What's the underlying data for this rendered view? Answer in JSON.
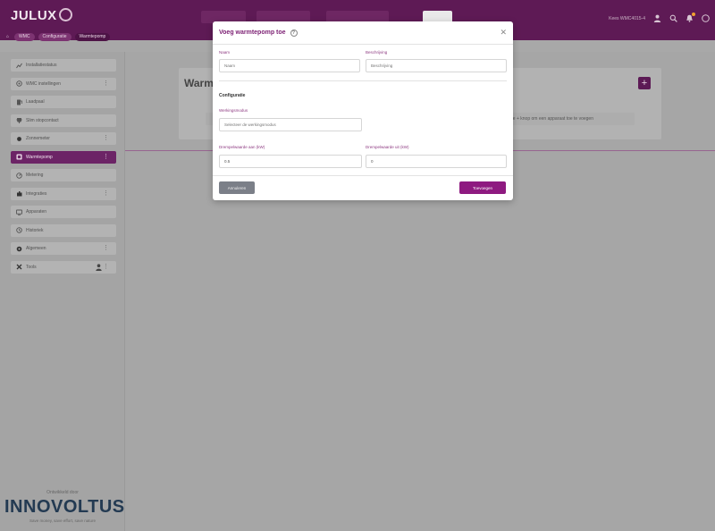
{
  "header": {
    "logo": "JULUX",
    "breadcrumbs": [
      "WMC",
      "Configuratie",
      "Warmtepomp"
    ],
    "account": "Kees WMC4015-4",
    "colors": {
      "brand": "#5e1a55",
      "accent": "#8e1a80"
    }
  },
  "sidebar": {
    "items": [
      {
        "label": "Installatiestatus",
        "icon": "chart-icon",
        "more": ""
      },
      {
        "label": "WMC instellingen",
        "icon": "settings-icon",
        "more": "⋮"
      },
      {
        "label": "Laadpaal",
        "icon": "charger-icon",
        "more": ""
      },
      {
        "label": "Slim stopcontact",
        "icon": "plug-icon",
        "more": ""
      },
      {
        "label": "Zonnemeter",
        "icon": "sun-icon",
        "more": "⋮"
      },
      {
        "label": "Warmtepomp",
        "icon": "heatpump-icon",
        "more": "⋮"
      },
      {
        "label": "Metering",
        "icon": "meter-icon",
        "more": ""
      },
      {
        "label": "Integraties",
        "icon": "puzzle-icon",
        "more": "⋮"
      },
      {
        "label": "Apparaten",
        "icon": "devices-icon",
        "more": ""
      },
      {
        "label": "Historiek",
        "icon": "history-icon",
        "more": ""
      },
      {
        "label": "Algemeen",
        "icon": "gear-icon",
        "more": "⋮"
      },
      {
        "label": "Tools",
        "icon": "wrench-icon",
        "more": "⋮"
      }
    ],
    "brand": {
      "sub": "Ontwikkeld door",
      "name": "INNOVOLTUS",
      "tagline": "Save money, save effort, save nature"
    }
  },
  "main": {
    "card_title": "Warmtepompen",
    "add_label": "+",
    "empty_text": "Klik op de + knop om een apparaat toe te voegen"
  },
  "modal": {
    "title": "Voeg warmtepomp toe",
    "help": "?",
    "close": "✕",
    "name_label": "Naam",
    "name_placeholder": "Naam",
    "desc_label": "Beschrijving",
    "desc_placeholder": "Beschrijving",
    "config_heading": "Configuratie",
    "mode_label": "Werkingsmodus",
    "mode_placeholder": "Selecteer de werkingsmodus",
    "threshold_on_label": "Drempelwaarde aan (kW)",
    "threshold_on_value": "0.5",
    "threshold_off_label": "Drempelwaarde uit (kW)",
    "threshold_off_value": "0",
    "cancel_label": "Annuleren",
    "save_label": "Toevoegen"
  }
}
